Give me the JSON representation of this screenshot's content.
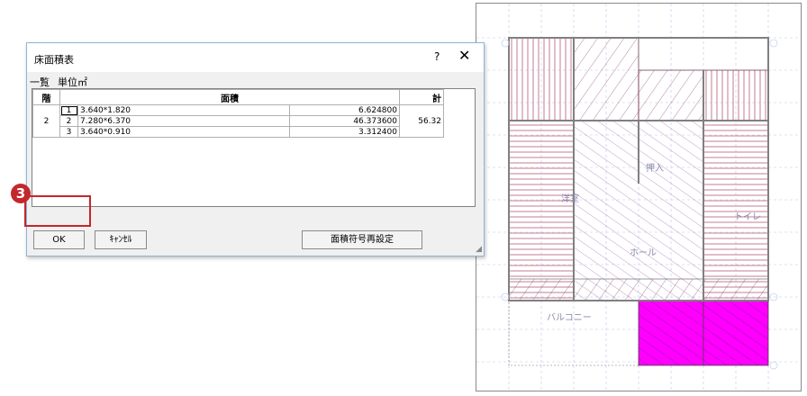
{
  "dialog": {
    "title": "床面積表",
    "help": "?",
    "close": "✕",
    "tab_list": "一覧",
    "unit_label": "単位㎡",
    "columns": {
      "floor": "階",
      "area": "面積",
      "total": "計"
    },
    "floor_value": "2",
    "total_value": "56.32",
    "rows": [
      {
        "no": "1",
        "dims": "3.640*1.820",
        "area": "6.624800"
      },
      {
        "no": "2",
        "dims": "7.280*6.370",
        "area": "46.373600"
      },
      {
        "no": "3",
        "dims": "3.640*0.910",
        "area": "3.312400"
      }
    ],
    "buttons": {
      "ok": "OK",
      "cancel": "ｷｬﾝｾﾙ",
      "reset": "面積符号再設定"
    }
  },
  "step_badge": "3",
  "colors": {
    "highlight": "#c3272c",
    "hatch_red": "#a0234a",
    "hatch_purple": "#9c5aa8",
    "magenta": "#ff00ff"
  },
  "plan": {
    "labels": [
      "押入",
      "洋室",
      "ホール",
      "バルコニー",
      "トイレ"
    ]
  }
}
